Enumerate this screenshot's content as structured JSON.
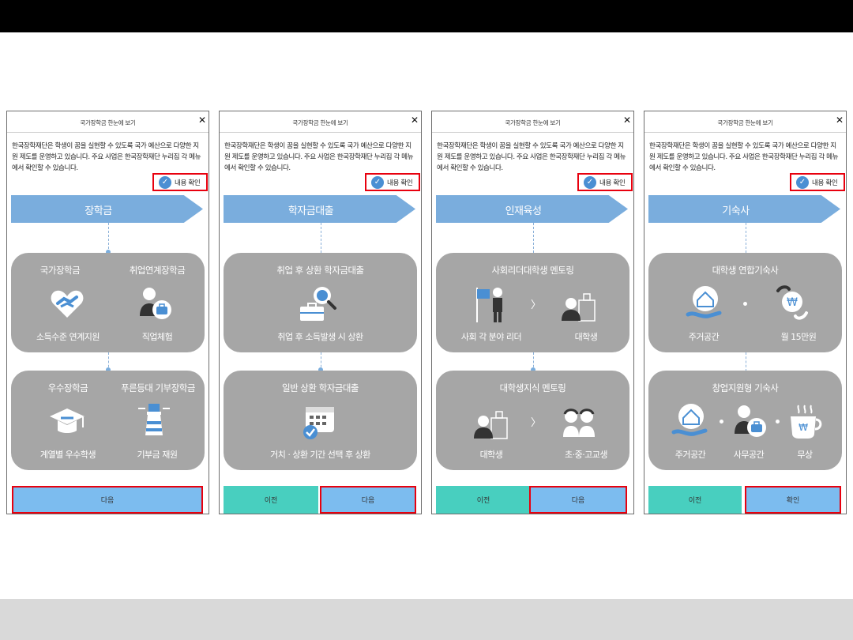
{
  "dialog_title": "국가장학금 한눈에 보기",
  "description": "한국장학재단은 학생이 꿈을 실현할 수 있도록 국가 예산으로 다양한 지원 제도를 운영하고 있습니다. 주요 사업은 한국장학재단 누리집 각 메뉴에서 확인할 수 있습니다.",
  "confirm_label": "내용 확인",
  "buttons": {
    "prev": "이전",
    "next": "다음",
    "ok": "확인"
  },
  "panels": [
    {
      "banner": "장학금",
      "card1": {
        "items": [
          {
            "title": "국가장학금",
            "label": "소득수준 연계지원"
          },
          {
            "title": "취업연계장학금",
            "label": "직업체험"
          }
        ]
      },
      "card2": {
        "items": [
          {
            "title": "우수장학금",
            "label": "계열별 우수학생"
          },
          {
            "title": "푸른등대 기부장학금",
            "label": "기부금 재원"
          }
        ]
      }
    },
    {
      "banner": "학자금대출",
      "card1": {
        "title": "취업 후 상환 학자금대출",
        "label": "취업 후 소득발생 시 상환"
      },
      "card2": {
        "title": "일반 상환 학자금대출",
        "label": "거치 · 상환 기간 선택 후 상환"
      }
    },
    {
      "banner": "인재육성",
      "card1": {
        "title": "사회리더대학생 멘토링",
        "labels": [
          "사회 각 분야 리더",
          "대학생"
        ]
      },
      "card2": {
        "title": "대학생지식 멘토링",
        "labels": [
          "대학생",
          "초·중·고교생"
        ]
      }
    },
    {
      "banner": "기숙사",
      "card1": {
        "title": "대학생 연합기숙사",
        "labels": [
          "주거공간",
          "월 15만원"
        ]
      },
      "card2": {
        "title": "창업지원형 기숙사",
        "labels": [
          "주거공간",
          "사무공간",
          "무상"
        ]
      }
    }
  ]
}
